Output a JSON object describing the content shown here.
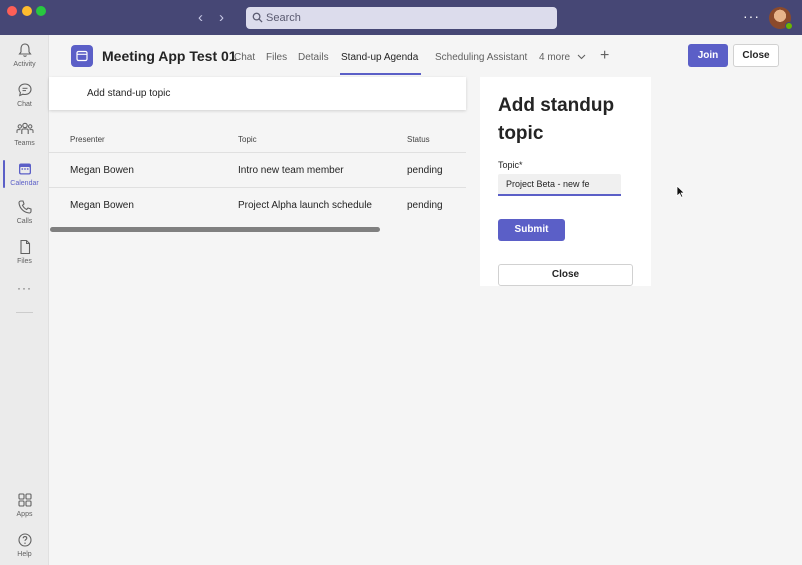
{
  "titlebar": {
    "search_placeholder": "Search"
  },
  "rail": {
    "items": [
      {
        "label": "Activity",
        "icon": "bell-icon"
      },
      {
        "label": "Chat",
        "icon": "chat-icon"
      },
      {
        "label": "Teams",
        "icon": "teams-icon"
      },
      {
        "label": "Calendar",
        "icon": "calendar-icon"
      },
      {
        "label": "Calls",
        "icon": "phone-icon"
      },
      {
        "label": "Files",
        "icon": "file-icon"
      },
      {
        "label": "Apps",
        "icon": "apps-icon"
      },
      {
        "label": "Help",
        "icon": "help-icon"
      }
    ],
    "more": "···"
  },
  "header": {
    "title": "Meeting App Test 01",
    "tabs": [
      {
        "label": "Chat"
      },
      {
        "label": "Files"
      },
      {
        "label": "Details"
      },
      {
        "label": "Stand-up Agenda"
      },
      {
        "label": "Scheduling Assistant"
      },
      {
        "label": "4 more"
      }
    ],
    "join_label": "Join",
    "close_label": "Close"
  },
  "main": {
    "add_topic_label": "Add stand-up topic",
    "table": {
      "columns": [
        "Presenter",
        "Topic",
        "Status"
      ],
      "rows": [
        [
          "Megan Bowen",
          "Intro new team member",
          "pending"
        ],
        [
          "Megan Bowen",
          "Project Alpha launch schedule",
          "pending"
        ]
      ]
    }
  },
  "panel": {
    "title": "Add standup topic",
    "field_label": "Topic*",
    "field_value": "Project Beta - new fe",
    "submit_label": "Submit",
    "close_label": "Close"
  },
  "colors": {
    "titlebar": "#464775",
    "accent": "#5b5fc7"
  }
}
